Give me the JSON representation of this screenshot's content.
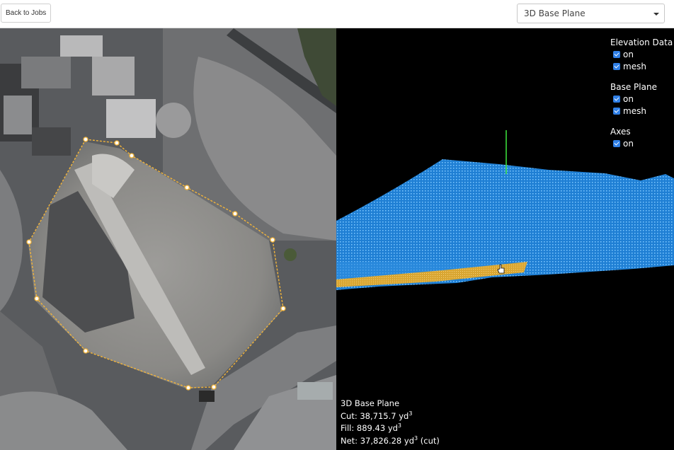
{
  "toolbar": {
    "back_label": "Back to Jobs",
    "view_select_value": "3D Base Plane"
  },
  "viewer": {
    "controls": {
      "elevation": {
        "title": "Elevation Data",
        "on_label": "on",
        "mesh_label": "mesh",
        "on": true,
        "mesh": true
      },
      "base_plane": {
        "title": "Base Plane",
        "on_label": "on",
        "mesh_label": "mesh",
        "on": true,
        "mesh": true
      },
      "axes": {
        "title": "Axes",
        "on_label": "on",
        "on": true
      }
    },
    "stats": {
      "title": "3D Base Plane",
      "cut_label": "Cut:",
      "cut_value": "38,715.7",
      "fill_label": "Fill:",
      "fill_value": "889.43",
      "net_label": "Net:",
      "net_value": "37,826.28",
      "net_suffix": "(cut)",
      "unit": "yd",
      "unit_power": "3"
    }
  },
  "colors": {
    "polygon": "#f2b43a",
    "mesh_blue": "#2a8fe0",
    "base_plane": "#e8b43a",
    "axis": "#3ee83e",
    "checkbox": "#2f7fe6"
  },
  "icons": {
    "cursor": "hand-cursor-icon",
    "select_caret": "caret-down-icon"
  }
}
